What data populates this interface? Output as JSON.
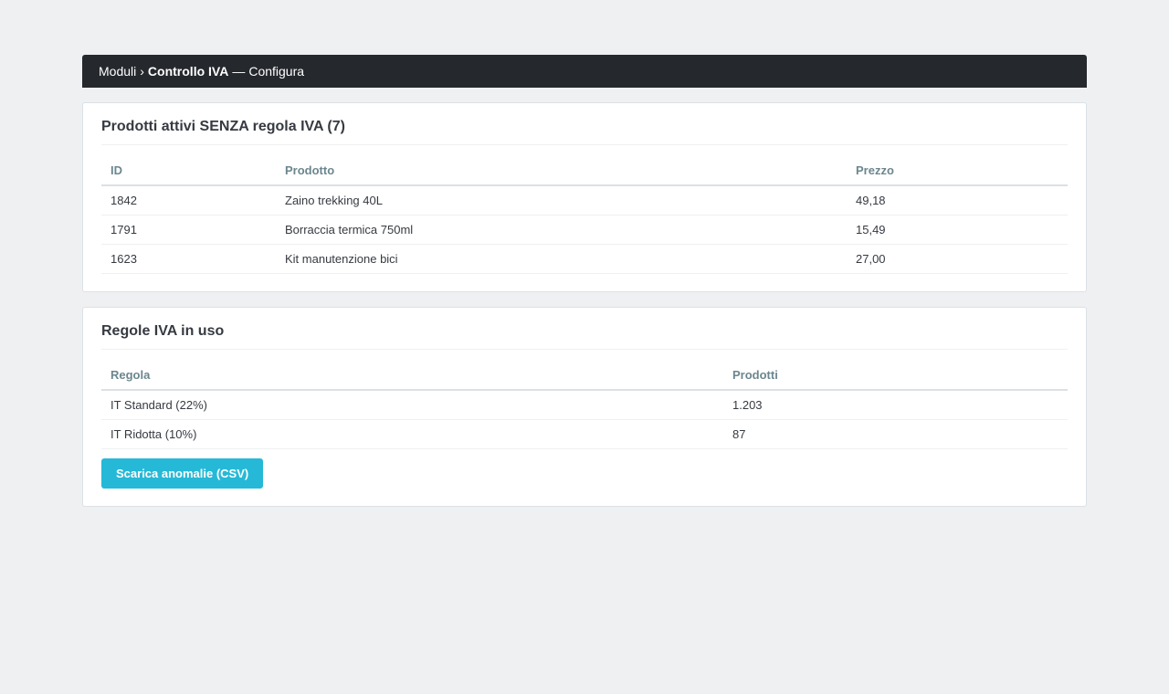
{
  "breadcrumb": {
    "parent": "Moduli",
    "separator": "›",
    "module": "Controllo IVA",
    "dash": "—",
    "action": "Configura"
  },
  "products_panel": {
    "title": "Prodotti attivi SENZA regola IVA (7)",
    "columns": [
      "ID",
      "Prodotto",
      "Prezzo"
    ],
    "rows": [
      {
        "id": "1842",
        "name": "Zaino trekking 40L",
        "price": "49,18"
      },
      {
        "id": "1791",
        "name": "Borraccia termica 750ml",
        "price": "15,49"
      },
      {
        "id": "1623",
        "name": "Kit manutenzione bici",
        "price": "27,00"
      }
    ]
  },
  "rules_panel": {
    "title": "Regole IVA in uso",
    "columns": [
      "Regola",
      "Prodotti"
    ],
    "rows": [
      {
        "rule": "IT Standard (22%)",
        "count": "1.203"
      },
      {
        "rule": "IT Ridotta (10%)",
        "count": "87"
      }
    ],
    "download_button": "Scarica anomalie (CSV)"
  },
  "colors": {
    "topbar": "#25282d",
    "accent": "#25b9d7",
    "background": "#eff0f2"
  }
}
